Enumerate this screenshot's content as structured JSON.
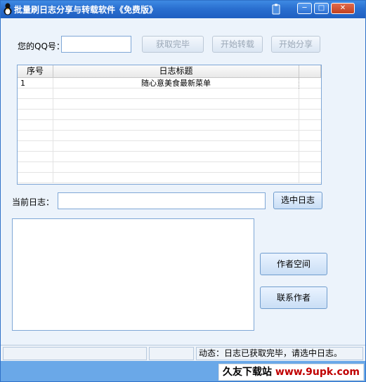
{
  "window": {
    "title": "批量刷日志分享与转载软件《免费版》",
    "controls": {
      "minimize": "─",
      "maximize": "□",
      "close": "✕"
    }
  },
  "qq": {
    "label": "您的QQ号：",
    "value": ""
  },
  "buttons": {
    "fetch": "获取完毕",
    "repost": "开始转载",
    "share": "开始分享",
    "select_log": "选中日志",
    "author_space": "作者空间",
    "contact_author": "联系作者"
  },
  "table": {
    "headers": [
      "序号",
      "日志标题"
    ],
    "rows": [
      {
        "index": "1",
        "title": "随心意美食最新菜单"
      }
    ]
  },
  "current_log": {
    "label": "当前日志：",
    "value": ""
  },
  "status": {
    "label": "动态：",
    "message": "日志已获取完毕，请选中日志。"
  },
  "watermark": {
    "name": "久友下载站",
    "url": "www.9upk.com"
  },
  "colors": {
    "title_bar": "#2a6fd0",
    "window_bg": "#ecf3fb",
    "border": "#7fa7d6",
    "footer": "#6aa8e8"
  },
  "icons": [
    "app-icon",
    "clipboard-icon",
    "minimize-icon",
    "maximize-icon",
    "close-icon"
  ]
}
